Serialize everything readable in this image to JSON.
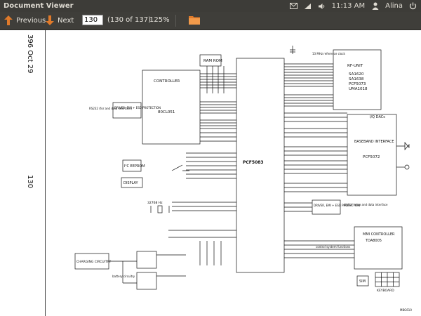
{
  "window": {
    "title": "Document Viewer"
  },
  "panel": {
    "time": "11:13 AM",
    "user": "Alina",
    "icons": [
      "mail-icon",
      "network-icon",
      "volume-icon",
      "user-icon",
      "power-icon"
    ]
  },
  "toolbar": {
    "previous_label": "Previous",
    "next_label": "Next",
    "page_value": "130",
    "page_count": "(130 of 137)",
    "zoom": "125%"
  },
  "margin": {
    "date_text": "396 Oct 29",
    "page_number": "130"
  },
  "schematic": {
    "ram_rom": "RAM ROM",
    "controller": "CONTROLLER",
    "controller_part": "80CL051",
    "main_chip": "PCF5083",
    "rf_unit": "RF-UNIT",
    "rf_parts": [
      "SA1620",
      "SA1638",
      "PCF5073",
      "UMA1018"
    ],
    "baseband": "BASEBAND INTERFACE",
    "baseband_part": "PCF5072",
    "driver1": "DRIVER, EMI + ESD PROTECTION",
    "driver2": "DRIVER, EMI + ESD PROTECTION",
    "eeprom": "I²C EEPROM",
    "display": "DISPLAY",
    "charging": "CHARGING CIRCUITRY",
    "mmi": "MMI CONTROLLER",
    "mmi_part": "TDA8005",
    "sim": "SIM",
    "keyboard": "KEYBOARD",
    "rs232": "RS232 (for and data interface)",
    "ref_13mhz": "13 MHz reference clock",
    "ref_32khz": "32768 Hz",
    "io_dacs": "I/Q DACs",
    "digital_voice": "digital voice and data interface",
    "control_functions": "control system functions",
    "battery": "battery circuitry",
    "figure_id": "MBG610"
  }
}
